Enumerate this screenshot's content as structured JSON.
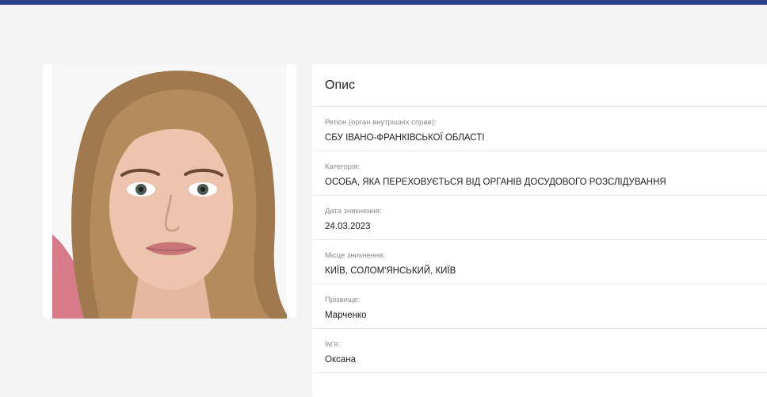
{
  "section_title": "Опис",
  "fields": [
    {
      "label": "Регіон (орган внутрішніх справ):",
      "value": "СБУ ІВАНО-ФРАНКІВСЬКОЇ ОБЛАСТІ"
    },
    {
      "label": "Категорія:",
      "value": "ОСОБА, ЯКА ПЕРЕХОВУЄТЬСЯ ВІД ОРГАНІВ ДОСУДОВОГО РОЗСЛІДУВАННЯ"
    },
    {
      "label": "Дата зникнення:",
      "value": "24.03.2023"
    },
    {
      "label": "Місце зникнення:",
      "value": "КИЇВ, СОЛОМ'ЯНСЬКИЙ, КИЇВ"
    },
    {
      "label": "Прізвище:",
      "value": "Марченко"
    },
    {
      "label": "Ім'я:",
      "value": "Оксана"
    }
  ],
  "colors": {
    "header_bar": "#2b3f8f",
    "background": "#f3f3f3",
    "card": "#ffffff"
  }
}
